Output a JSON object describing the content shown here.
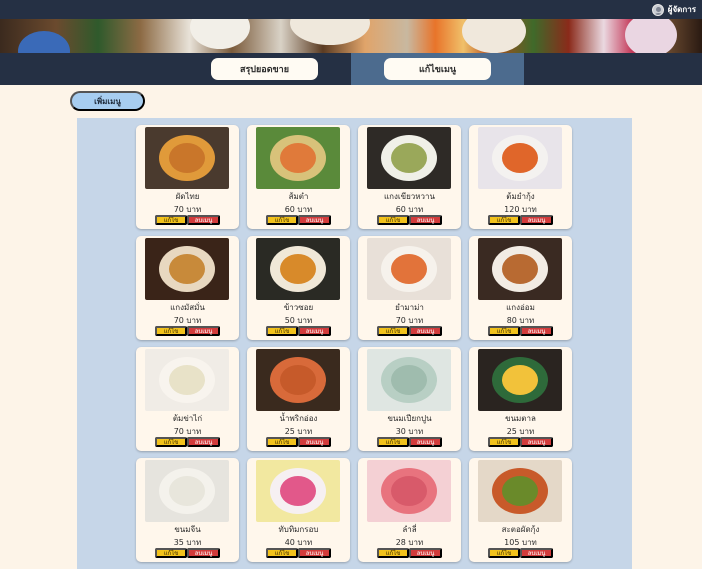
{
  "header": {
    "user_name": "ผู้จัดการ",
    "user_icon": "user-avatar-icon"
  },
  "tabs": [
    {
      "label": "สรุปยอดขาย",
      "active": false
    },
    {
      "label": "แก้ไขเมนู",
      "active": true
    }
  ],
  "add_menu_label": "เพิ่มเมนู",
  "colors": {
    "topbar": "#253044",
    "active_tab": "#4c6b8e",
    "add_button": "#a7cdf0",
    "panel": "#c6d6e8",
    "edit_button": "#f2c21b",
    "delete_button": "#d23b3b",
    "page_bg": "#fdf4e8"
  },
  "menu_items": [
    {
      "name": "ผัดไทย",
      "price": "70 บาท",
      "edit_label": "แก้ไข",
      "delete_label": "ลบเมนู",
      "bg": "#4a3a2e",
      "dish": "#e09a3a",
      "inner": "#c9762a"
    },
    {
      "name": "ส้มตำ",
      "price": "60 บาท",
      "edit_label": "แก้ไข",
      "delete_label": "ลบเมนู",
      "bg": "#5a8a3a",
      "dish": "#d8c27a",
      "inner": "#e07a3a"
    },
    {
      "name": "แกงเขียวหวาน",
      "price": "60 บาท",
      "edit_label": "แก้ไข",
      "delete_label": "ลบเมนู",
      "bg": "#2e2a26",
      "dish": "#f0f0e8",
      "inner": "#9aa85a"
    },
    {
      "name": "ต้มยำกุ้ง",
      "price": "120 บาท",
      "edit_label": "แก้ไข",
      "delete_label": "ลบเมนู",
      "bg": "#e8e4ea",
      "dish": "#f4f2f0",
      "inner": "#e0662a"
    },
    {
      "name": "แกงมัสมั่น",
      "price": "70 บาท",
      "edit_label": "แก้ไข",
      "delete_label": "ลบเมนู",
      "bg": "#3a2418",
      "dish": "#e8d8c0",
      "inner": "#c88a3a"
    },
    {
      "name": "ข้าวซอย",
      "price": "50 บาท",
      "edit_label": "แก้ไข",
      "delete_label": "ลบเมนู",
      "bg": "#2a2a24",
      "dish": "#f0e8d8",
      "inner": "#d88a2a"
    },
    {
      "name": "ยำมาม่า",
      "price": "70 บาท",
      "edit_label": "แก้ไข",
      "delete_label": "ลบเมนู",
      "bg": "#e8e0d8",
      "dish": "#f6f2ec",
      "inner": "#e2733a"
    },
    {
      "name": "แกงอ่อม",
      "price": "80 บาท",
      "edit_label": "แก้ไข",
      "delete_label": "ลบเมนู",
      "bg": "#3a2a22",
      "dish": "#f2ece4",
      "inner": "#b86a32"
    },
    {
      "name": "ต้มข่าไก่",
      "price": "70 บาท",
      "edit_label": "แก้ไข",
      "delete_label": "ลบเมนู",
      "bg": "#f0ece6",
      "dish": "#f8f4ee",
      "inner": "#e8e2c8"
    },
    {
      "name": "น้ำพริกอ่อง",
      "price": "25 บาท",
      "edit_label": "แก้ไข",
      "delete_label": "ลบเมนู",
      "bg": "#3a2a1e",
      "dish": "#d86a3a",
      "inner": "#c65a2a"
    },
    {
      "name": "ขนมเปียกปูน",
      "price": "30 บาท",
      "edit_label": "แก้ไข",
      "delete_label": "ลบเมนู",
      "bg": "#dfe6e2",
      "dish": "#b8cfc4",
      "inner": "#9fbcae"
    },
    {
      "name": "ขนมตาล",
      "price": "25 บาท",
      "edit_label": "แก้ไข",
      "delete_label": "ลบเมนู",
      "bg": "#2a2420",
      "dish": "#2e6a3a",
      "inner": "#f2c23a"
    },
    {
      "name": "ขนมจีน",
      "price": "35 บาท",
      "edit_label": "แก้ไข",
      "delete_label": "ลบเมนู",
      "bg": "#e6e4de",
      "dish": "#f4f2ec",
      "inner": "#e8e6dc"
    },
    {
      "name": "ทับทิมกรอบ",
      "price": "40 บาท",
      "edit_label": "แก้ไข",
      "delete_label": "ลบเมนู",
      "bg": "#f2e8a0",
      "dish": "#f6f0f2",
      "inner": "#e2588a"
    },
    {
      "name": "ลำลี่",
      "price": "28 บาท",
      "edit_label": "แก้ไข",
      "delete_label": "ลบเมนู",
      "bg": "#f4d0d4",
      "dish": "#e8737e",
      "inner": "#d85a6a"
    },
    {
      "name": "สะตอผัดกุ้ง",
      "price": "105 บาท",
      "edit_label": "แก้ไข",
      "delete_label": "ลบเมนู",
      "bg": "#e4d8c8",
      "dish": "#c85a2a",
      "inner": "#6a8a2a"
    }
  ]
}
